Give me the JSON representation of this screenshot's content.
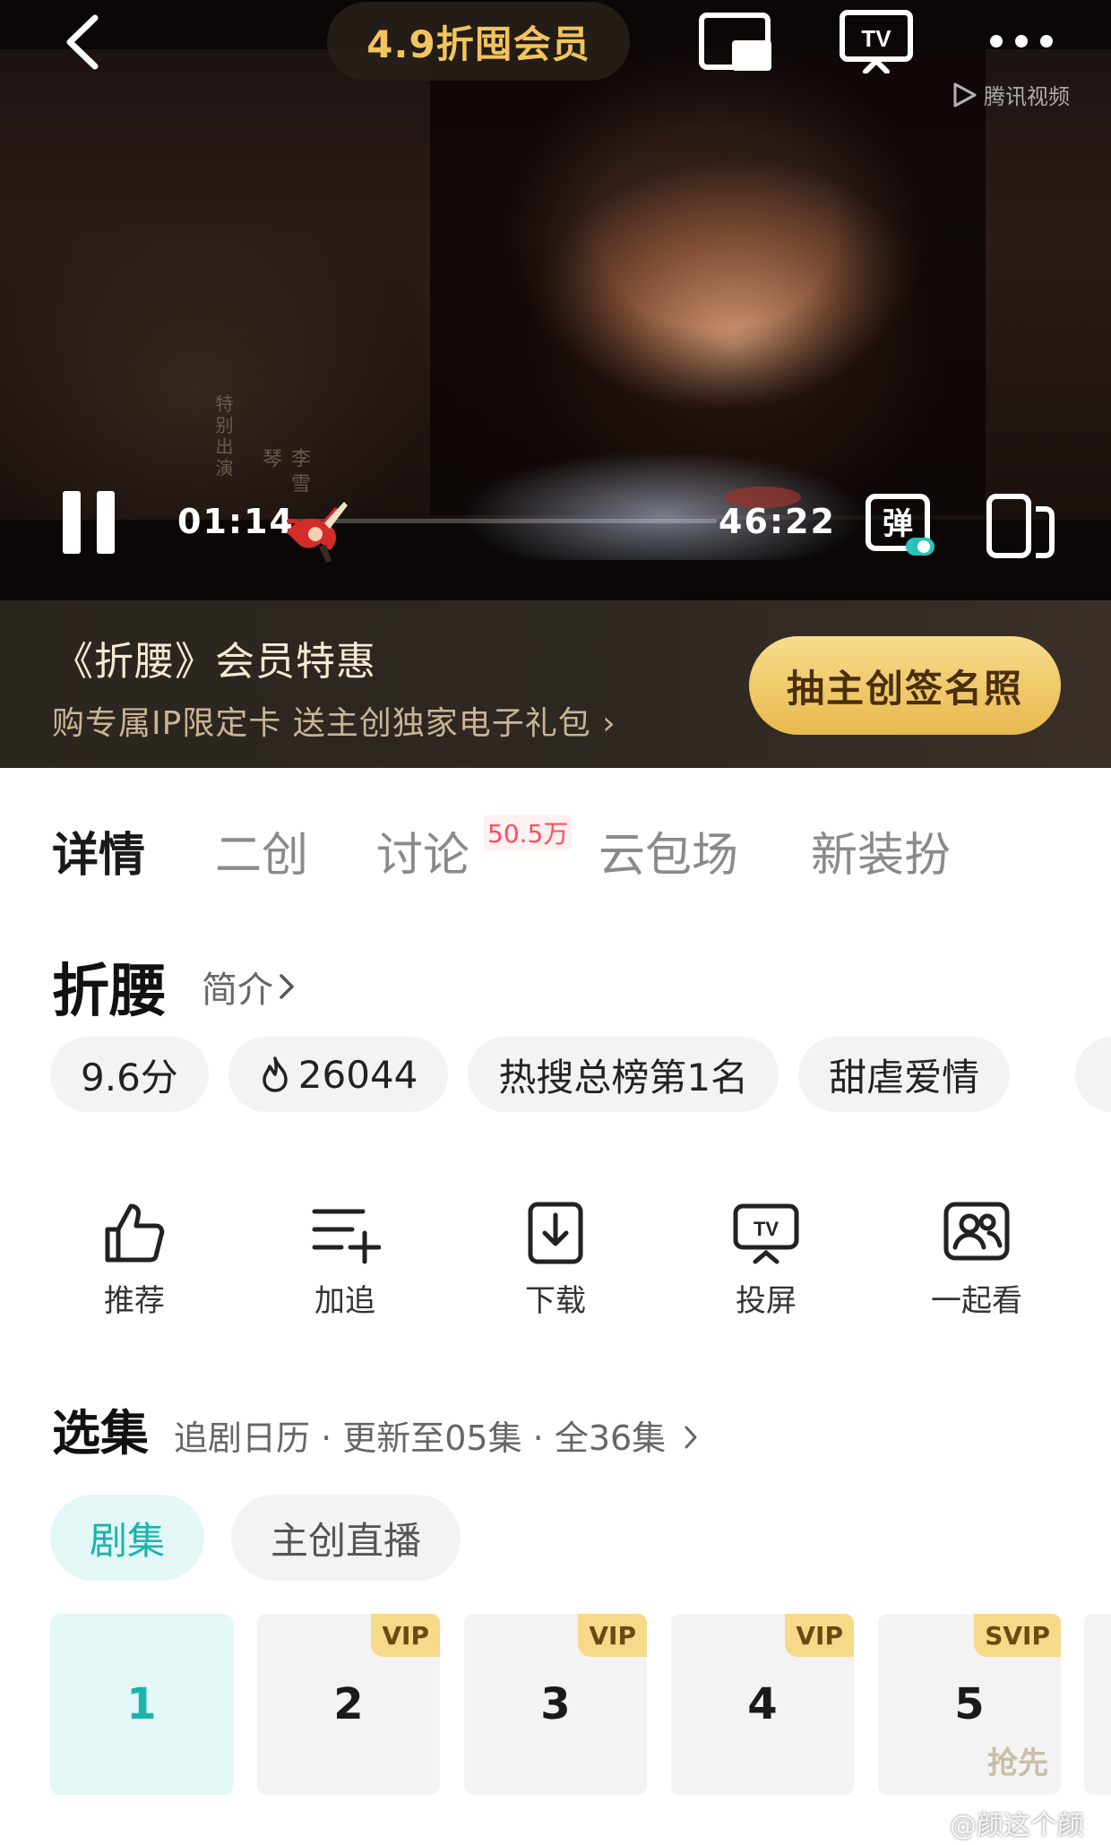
{
  "player": {
    "promo": "4.9折囤会员",
    "watermark_logo": "腾讯视频",
    "credit_role": "特别出演",
    "credit_name": "李雪琴",
    "time_current": "01:14",
    "time_total": "46:22",
    "progress": 0.027,
    "danmaku_label": "弹",
    "danmaku_on": true
  },
  "banner": {
    "title": "《折腰》会员特惠",
    "subtitle": "购专属IP限定卡 送主创独家电子礼包 ›",
    "cta": "抽主创签名照"
  },
  "tabs": [
    {
      "label": "详情",
      "active": true
    },
    {
      "label": "二创"
    },
    {
      "label": "讨论",
      "badge": "50.5万"
    },
    {
      "label": "云包场"
    },
    {
      "label": "新装扮"
    }
  ],
  "show": {
    "title": "折腰",
    "intro_link": "简介",
    "tags": [
      "9.6分",
      "26044",
      "热搜总榜第1名",
      "甜虐爱情"
    ]
  },
  "actions": [
    {
      "label": "推荐",
      "icon": "thumbs-up-icon"
    },
    {
      "label": "加追",
      "icon": "playlist-add-icon"
    },
    {
      "label": "下载",
      "icon": "download-icon"
    },
    {
      "label": "投屏",
      "icon": "tv-cast-icon"
    },
    {
      "label": "一起看",
      "icon": "watch-together-icon"
    }
  ],
  "episodes": {
    "title": "选集",
    "meta": "追剧日历 · 更新至05集 · 全36集",
    "tabs": [
      {
        "label": "剧集",
        "active": true
      },
      {
        "label": "主创直播"
      }
    ],
    "items": [
      {
        "num": "1",
        "badge": "",
        "sub": "",
        "active": true
      },
      {
        "num": "2",
        "badge": "VIP",
        "sub": ""
      },
      {
        "num": "3",
        "badge": "VIP",
        "sub": ""
      },
      {
        "num": "4",
        "badge": "VIP",
        "sub": ""
      },
      {
        "num": "5",
        "badge": "SVIP",
        "sub": "抢先"
      }
    ]
  },
  "page_watermark": "@颜这个颜",
  "colors": {
    "accent": "#1bb3ad",
    "gold": "#f2c45e",
    "progress": "#d12a2a",
    "badge_red": "#ff4d5a",
    "vip_badge": "#f7d98a"
  }
}
